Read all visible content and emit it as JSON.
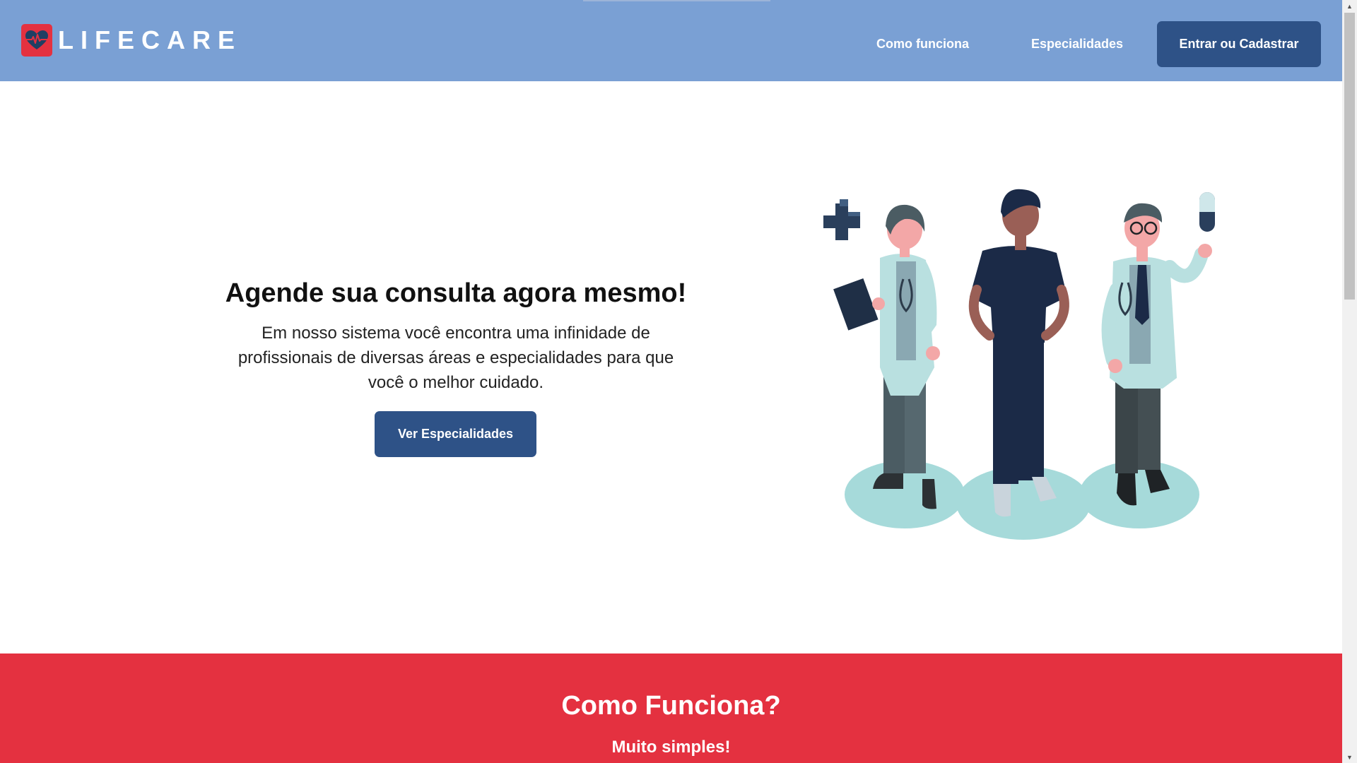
{
  "header": {
    "logo_text": "LIFECARE",
    "nav": {
      "how_it_works": "Como funciona",
      "specialties": "Especialidades"
    },
    "login_button": "Entrar ou Cadastrar"
  },
  "hero": {
    "title": "Agende sua consulta agora mesmo!",
    "description": "Em nosso sistema você encontra uma infinidade de profissionais de diversas áreas e especialidades para que você o melhor cuidado.",
    "button": "Ver Especialidades",
    "illustration_icon": "doctors-illustration"
  },
  "how_it_works": {
    "title": "Como Funciona?",
    "subtitle": "Muito simples!"
  },
  "colors": {
    "header_bg": "#7aa0d4",
    "primary_button": "#2e5287",
    "accent_red": "#e43140"
  }
}
